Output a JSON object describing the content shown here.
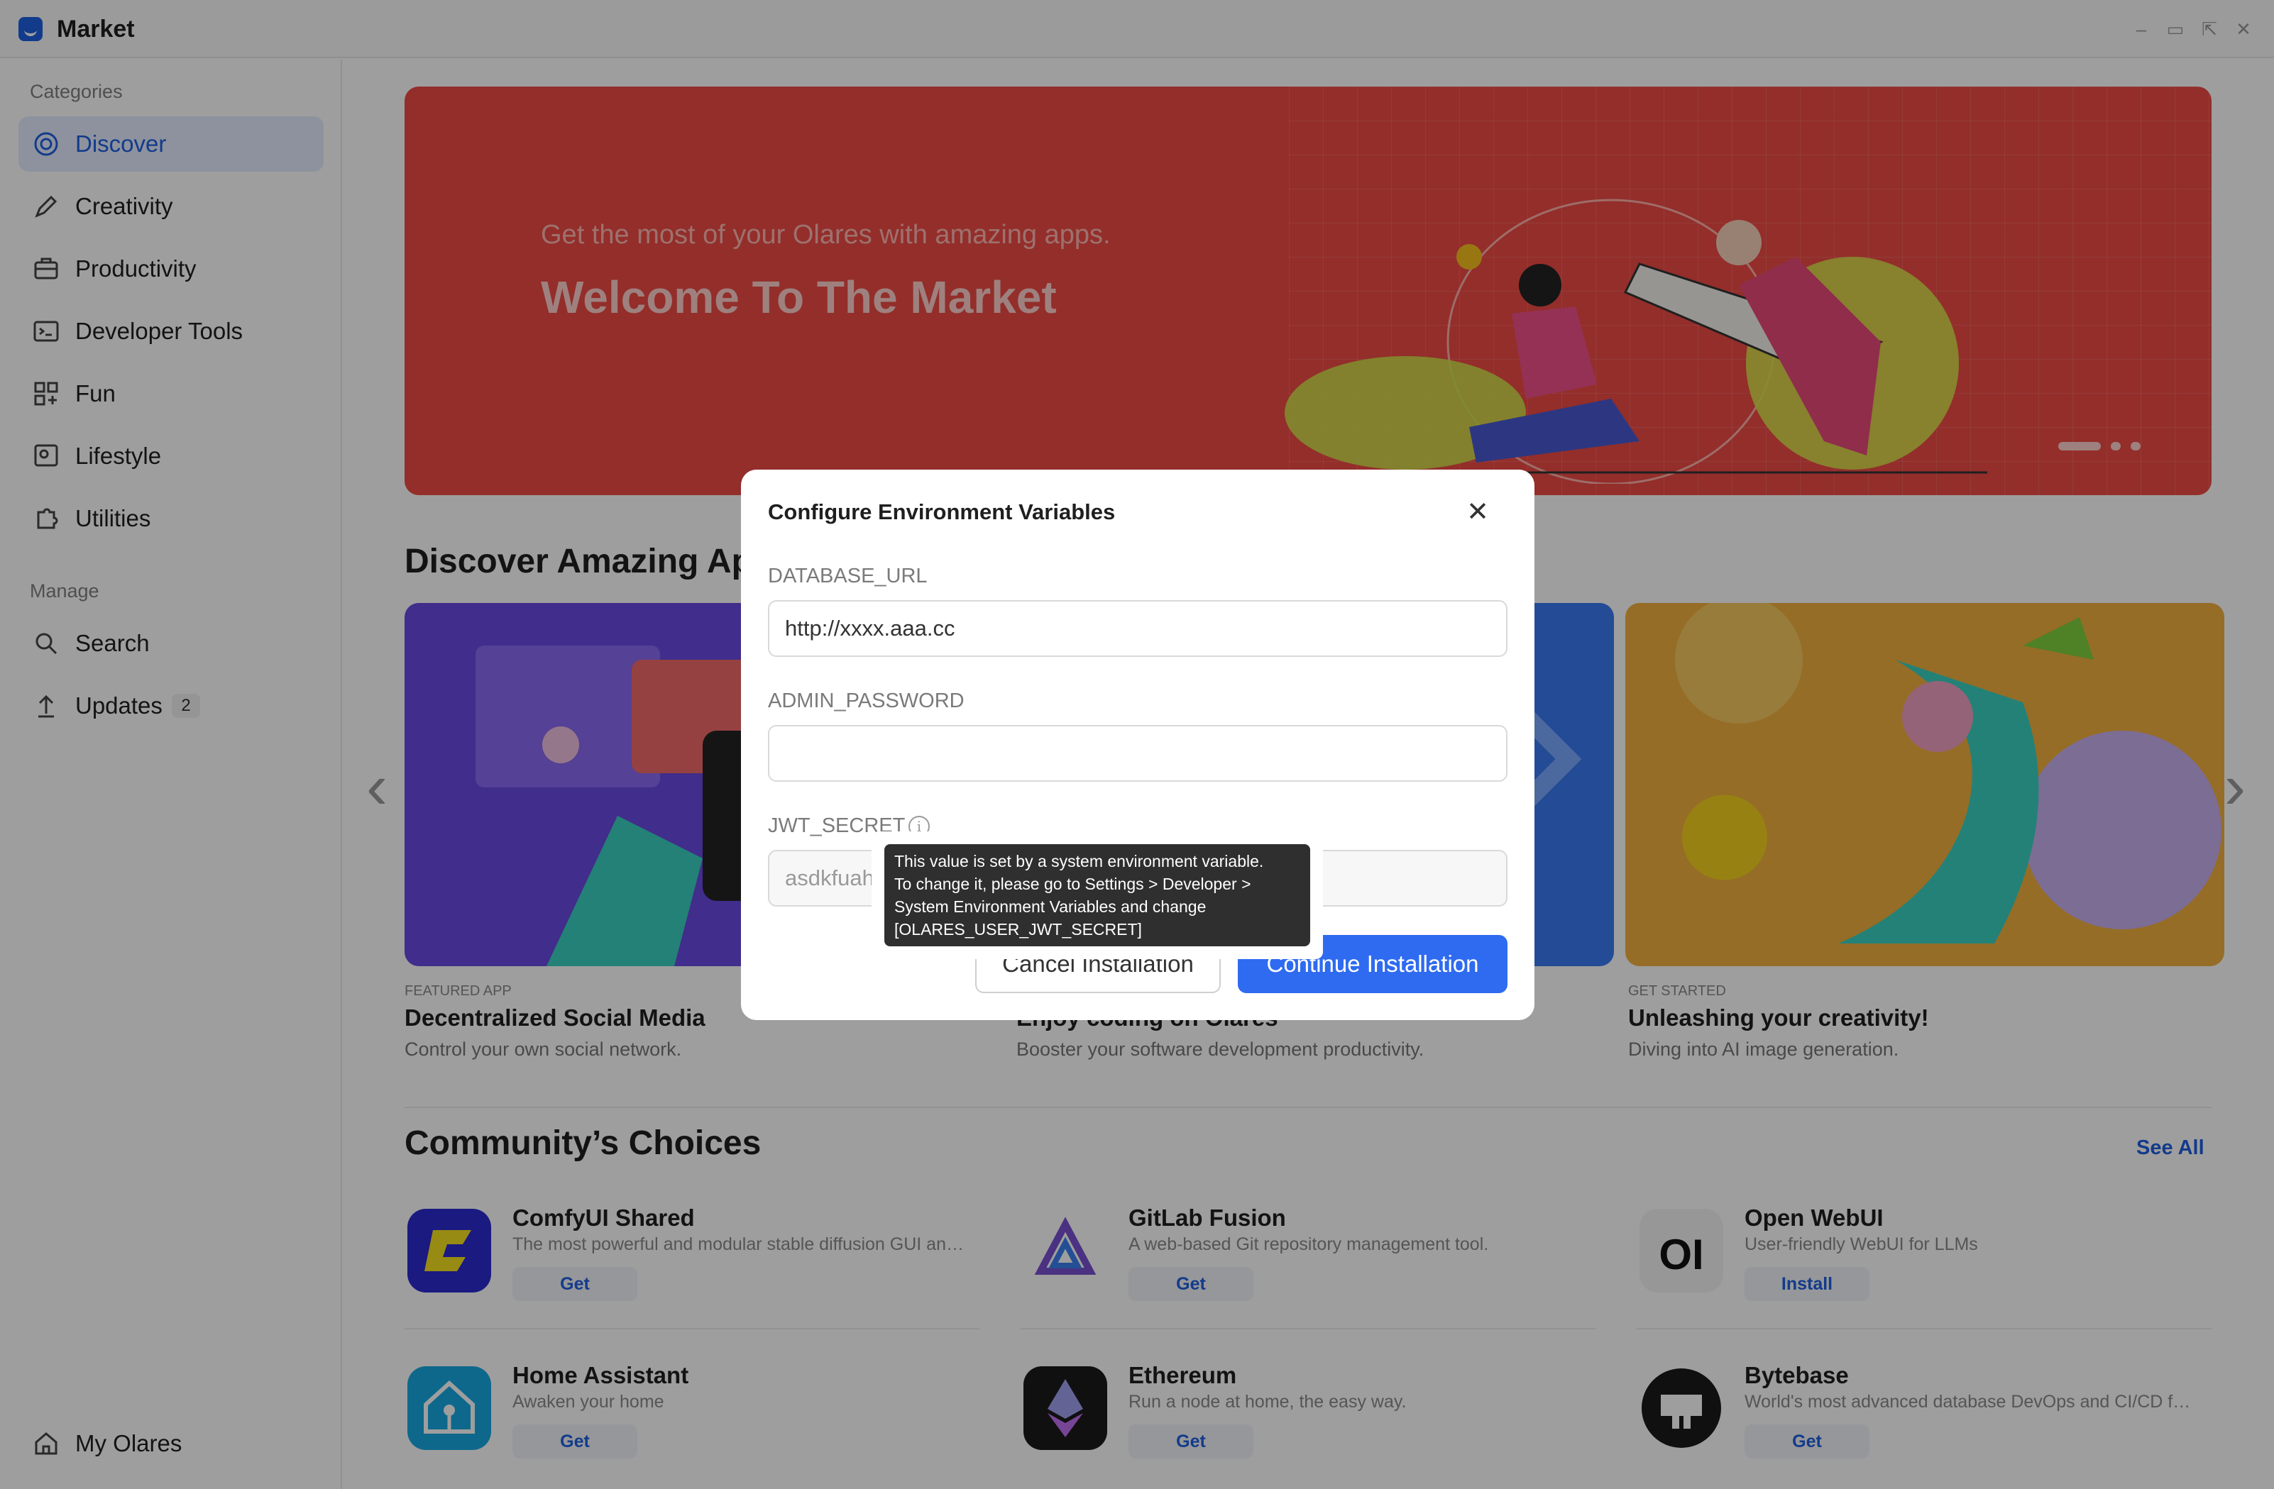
{
  "window": {
    "title": "Market"
  },
  "sidebar": {
    "categories_heading": "Categories",
    "categories": [
      {
        "label": "Discover",
        "icon": "discover-icon",
        "active": true
      },
      {
        "label": "Creativity",
        "icon": "creativity-icon"
      },
      {
        "label": "Productivity",
        "icon": "productivity-icon"
      },
      {
        "label": "Developer Tools",
        "icon": "developer-tools-icon"
      },
      {
        "label": "Fun",
        "icon": "fun-icon"
      },
      {
        "label": "Lifestyle",
        "icon": "lifestyle-icon"
      },
      {
        "label": "Utilities",
        "icon": "utilities-icon"
      }
    ],
    "manage_heading": "Manage",
    "manage": [
      {
        "label": "Search",
        "icon": "search-icon"
      },
      {
        "label": "Updates",
        "icon": "updates-icon",
        "badge": "2"
      }
    ],
    "footer": {
      "label": "My Olares",
      "icon": "home-icon"
    }
  },
  "banner": {
    "subtitle": "Get the most of your Olares with amazing apps.",
    "title": "Welcome To The Market",
    "color": "#ee4b46"
  },
  "discover": {
    "title": "Discover Amazing Apps",
    "cards": [
      {
        "meta": "FEATURED APP",
        "title": "Decentralized Social Media",
        "desc": "Control your own social network."
      },
      {
        "meta": "",
        "title": "Enjoy coding on Olares",
        "desc": "Booster your software development productivity."
      },
      {
        "meta": "GET STARTED",
        "title": "Unleashing your creativity!",
        "desc": "Diving into AI image generation."
      }
    ]
  },
  "community": {
    "title": "Community’s Choices",
    "see_all": "See All",
    "apps": [
      {
        "name": "ComfyUI Shared",
        "desc": "The most powerful and modular stable diffusion GUI and ba...",
        "action": "Get"
      },
      {
        "name": "GitLab Fusion",
        "desc": "A web-based Git repository management tool.",
        "action": "Get"
      },
      {
        "name": "Open WebUI",
        "desc": "User-friendly WebUI for LLMs",
        "action": "Install",
        "logo_text": "OI"
      },
      {
        "name": "Home Assistant",
        "desc": "Awaken your home",
        "action": "Get"
      },
      {
        "name": "Ethereum",
        "desc": "Run a node at home, the easy way.",
        "action": "Get"
      },
      {
        "name": "Bytebase",
        "desc": "World's most advanced database DevOps and CI/CD for Dev...",
        "action": "Get"
      }
    ]
  },
  "dialog": {
    "title": "Configure Environment Variables",
    "fields": [
      {
        "label": "DATABASE_URL",
        "value": "http://xxxx.aaa.cc"
      },
      {
        "label": "ADMIN_PASSWORD",
        "value": ""
      },
      {
        "label": "JWT_SECRET",
        "value": "asdkfuahsdf"
      }
    ],
    "cancel": "Cancel Installation",
    "continue": "Continue Installation",
    "tooltip": "This value is set by a system environment variable.\nTo change it, please go to Settings > Developer >\nSystem Environment Variables and change\n[OLARES_USER_JWT_SECRET]",
    "accent": "#2f6bf0"
  }
}
